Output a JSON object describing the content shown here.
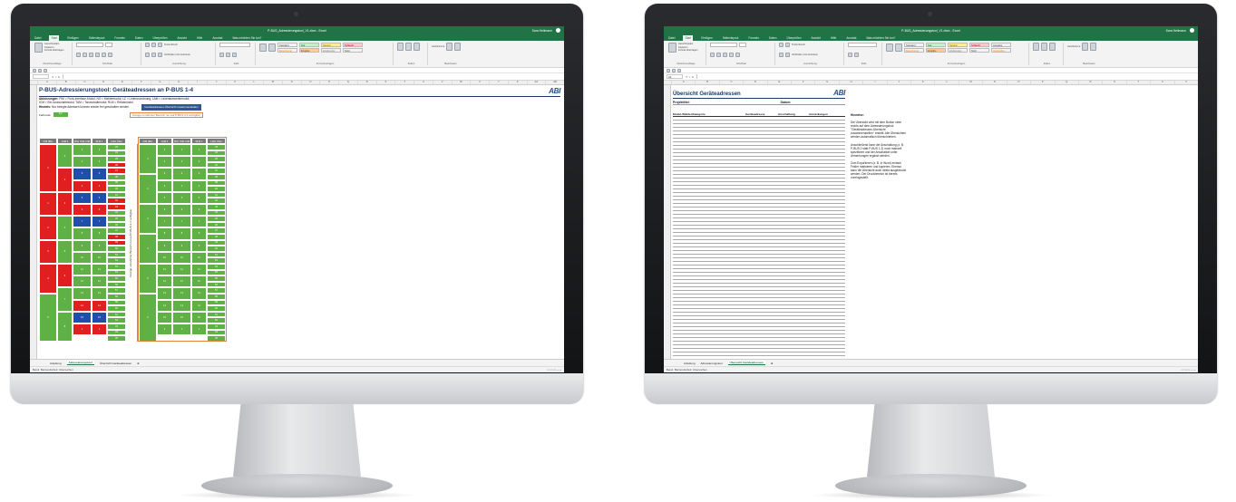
{
  "colors": {
    "excel_green": "#217346",
    "cell_green": "#5fb045",
    "cell_red": "#e02020",
    "cell_blue": "#1f4fa8",
    "orange": "#e8823a"
  },
  "excel": {
    "app_title_left": "P-BUS_Adressierungstool_V1.xlsm - Excel",
    "app_title_right": "P-BUS_Adressierungstool_V1.xlsm - Excel",
    "user": "Sara Heilmann",
    "tabs": [
      "Datei",
      "Start",
      "Einfügen",
      "Seitenlayout",
      "Formeln",
      "Daten",
      "Überprüfen",
      "Ansicht",
      "Hilfe",
      "Acrobat"
    ],
    "tell_me": "Was möchten Sie tun?",
    "ribbon_groups": [
      "Zwischenablage",
      "Schriftart",
      "Ausrichtung",
      "Zahl",
      "Formatvorlagen",
      "Zellen",
      "Bearbeiten"
    ],
    "clipboard": {
      "cut": "Ausschneiden",
      "copy": "Kopieren",
      "format": "Format übertragen",
      "paste": "Einfügen"
    },
    "styles": [
      "Standard",
      "Gut",
      "Neutral",
      "Schlecht",
      "Ausgabe",
      "Berechnung",
      "Eingabe",
      "Erklärender...",
      "Notiz",
      "Verknüpfte..."
    ],
    "wrap": "Textumbruch",
    "merge": "Verbinden und zentrieren",
    "cond_fmt": "Bedingte Formatierung",
    "as_table": "Als Tabelle formatieren",
    "cells_btns": [
      "Einfügen",
      "Löschen",
      "Format"
    ],
    "edit_btns": [
      "AutoSumme",
      "Ausfüllen",
      "Löschen",
      "Sortieren und Filtern",
      "Suchen und Auswählen"
    ],
    "namebox_right": "A1",
    "status_left": "Bereit",
    "status_access": "Barrierefreiheit: Untersuchen"
  },
  "left_sheet": {
    "title": "P-BUS-Adressierungstool: Geräteadressen an P-BUS 1-4",
    "abbrev_label": "Abkürzungen:",
    "abbrev_1": "FIM = Funk-Interface-Modul; NO = Meldermodul; LZ = Linienzuordnung; LAM = Linienauswertemodul;",
    "abbrev_2": "ICM = Ein-/Ausschaltmodul; TAM = Tanzschaltmodul; RLM = Relaismodul",
    "hint_label": "Hinweis:",
    "hint_text": "Nur belegte Adressen können wieder frei geschalten werden",
    "button": "Geräteadressen-Übersicht zusammenstellen",
    "legend_label": "Farbcode",
    "legend_free": "frei",
    "legend_orange": "Orange umrahmter Bereich nur auf P-BUS 3,4 verfügbar",
    "col_headers": [
      "FIM (BG)",
      "LAM 4",
      "FIM, TAM, FIM (L2)",
      "RLM 1",
      "LAM, Über Melder"
    ],
    "rot_label": "Orange umrahmter Bereich nur auf P-BUS 3,4 verfügbar",
    "sheet_tabs": [
      "Anleitung",
      "Adressierungstool",
      "Übersicht Geräteadressen"
    ],
    "active_tab": "Adressierungstool",
    "group_labels": [
      "1",
      "1",
      "2",
      "3",
      "4",
      "5",
      "6",
      "7"
    ],
    "right_group_labels": [
      "1",
      "2",
      "3",
      "4",
      "5",
      "6",
      "7"
    ],
    "small_labels": [
      "1",
      "2",
      "3",
      "4",
      "5",
      "6",
      "7",
      "8",
      "9",
      "10",
      "11",
      "12",
      "13",
      "14",
      "15"
    ],
    "addr_labels": [
      "33",
      "34",
      "35",
      "36",
      "37",
      "38",
      "39",
      "40",
      "41",
      "42",
      "43",
      "44",
      "45",
      "46",
      "47",
      "48",
      "49",
      "50",
      "51",
      "52",
      "53",
      "54",
      "55",
      "56",
      "57",
      "58",
      "59",
      "60",
      "61",
      "62"
    ],
    "bottom_labels": [
      "13",
      "13"
    ]
  },
  "right_sheet": {
    "title": "Übersicht Geräteadressen",
    "project_label": "Projekttitel:",
    "date_label": "Datum:",
    "headers": [
      "Modul-/Meldertkategorie",
      "Geräteadresse",
      "Anschaltung",
      "Anmerkungen"
    ],
    "hint_title": "Hinweise:",
    "hint_p1": "Die Übersicht wird mit dem Button oben rechts auf dem Adressierungstool \"Geräteadressen-Übersicht zusammenstellen\" erstellt. Alle Übersichten werden automatisch überschrieben.",
    "hint_p2": "Anschließend kann die Anschaltung (z. B. P-BUS 2 statt P-BUS 1,2) noch manuell spezifiziert und der Anschaltort unter Anmerkungen ergänzt werden.",
    "hint_p3": "Zum Exportieren (z. B. in Word) einfach Felder markieren und kopieren. Ebenso kann die Übersicht auch direkt ausgedruckt werden. Der Druckbereich ist bereits voreingestellt.",
    "sheet_tabs": [
      "Anleitung",
      "Adressierungstool",
      "Übersicht Geräteadressen"
    ],
    "active_tab": "Übersicht Geräteadressen"
  }
}
